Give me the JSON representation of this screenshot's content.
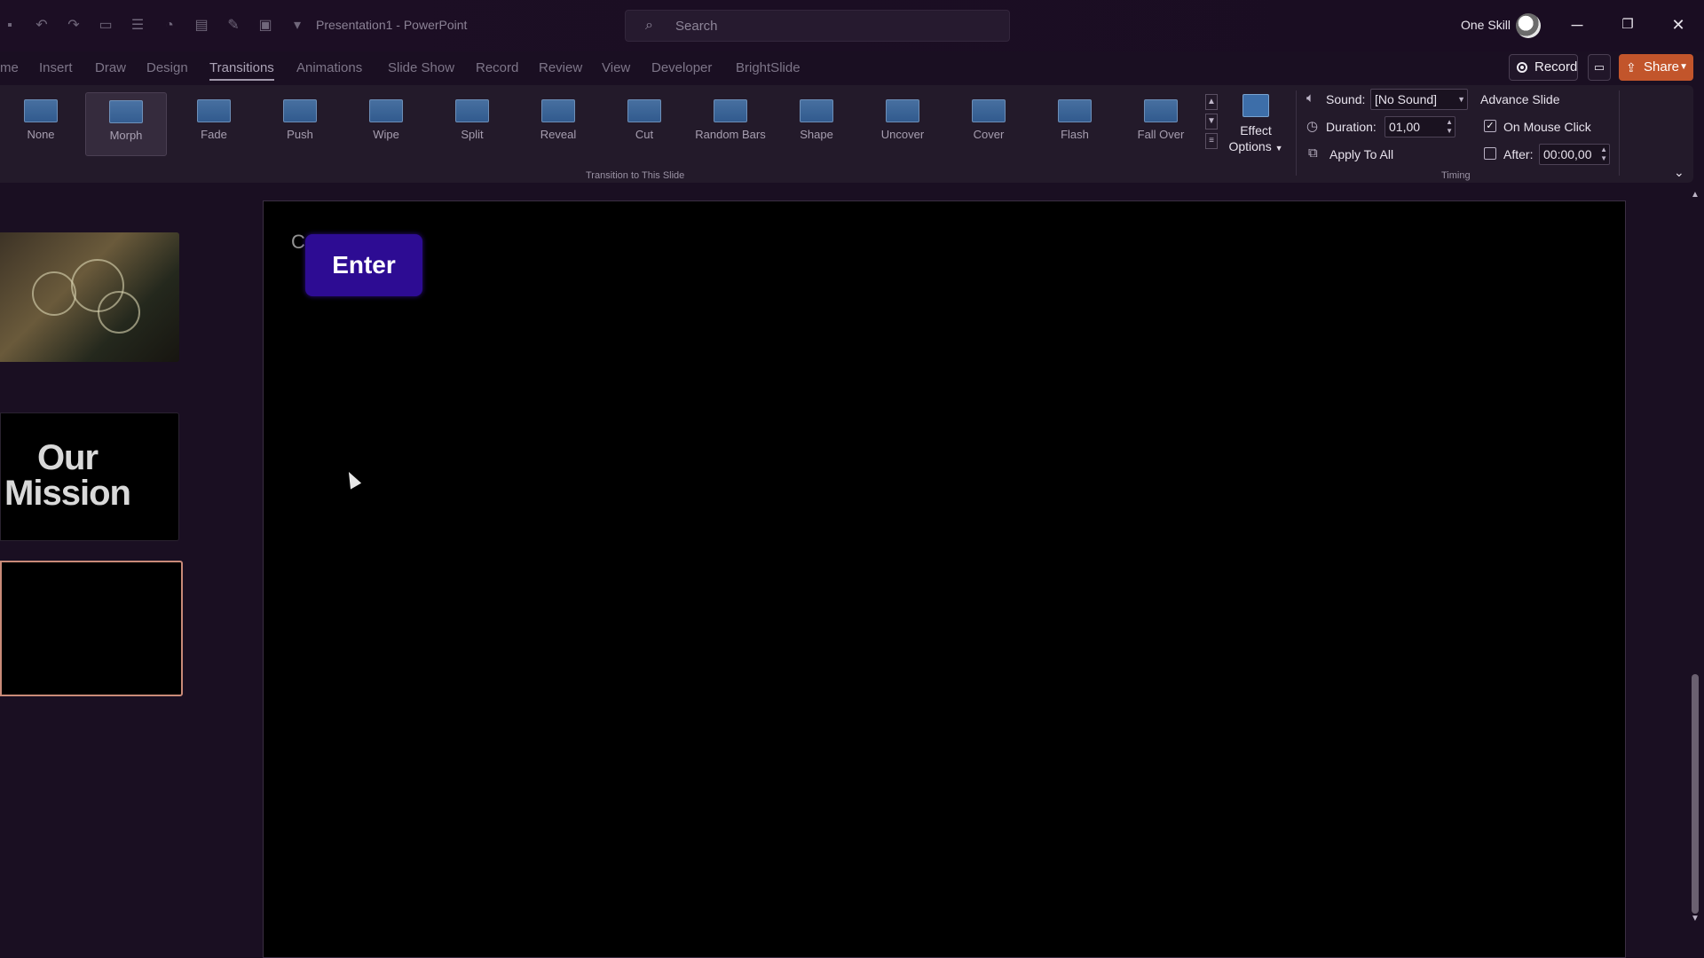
{
  "window": {
    "title": "Presentation1 - PowerPoint",
    "search_placeholder": "Search",
    "user_name": "One Skill",
    "minimize_glyph": "─",
    "restore_glyph": "❐",
    "close_glyph": "✕"
  },
  "quick_access_icons": [
    "autosave-icon",
    "undo-icon",
    "redo-icon",
    "toolbar-icon-1",
    "toolbar-icon-2",
    "toolbar-icon-3",
    "toolbar-icon-4",
    "toolbar-icon-5",
    "toolbar-icon-6",
    "customize-qat-icon"
  ],
  "tabs": [
    {
      "label": "me",
      "active": false
    },
    {
      "label": "Insert",
      "active": false
    },
    {
      "label": "Draw",
      "active": false
    },
    {
      "label": "Design",
      "active": false
    },
    {
      "label": "Transitions",
      "active": true
    },
    {
      "label": "Animations",
      "active": false
    },
    {
      "label": "Slide Show",
      "active": false
    },
    {
      "label": "Record",
      "active": false
    },
    {
      "label": "Review",
      "active": false
    },
    {
      "label": "View",
      "active": false
    },
    {
      "label": "Developer",
      "active": false
    },
    {
      "label": "BrightSlide",
      "active": false
    }
  ],
  "header_buttons": {
    "record": "Record",
    "share": "Share",
    "share_color": "#c2552b"
  },
  "transitions": {
    "items": [
      {
        "label": "None",
        "selected": false
      },
      {
        "label": "Morph",
        "selected": true
      },
      {
        "label": "Fade",
        "selected": false
      },
      {
        "label": "Push",
        "selected": false
      },
      {
        "label": "Wipe",
        "selected": false
      },
      {
        "label": "Split",
        "selected": false
      },
      {
        "label": "Reveal",
        "selected": false
      },
      {
        "label": "Cut",
        "selected": false
      },
      {
        "label": "Random Bars",
        "selected": false
      },
      {
        "label": "Shape",
        "selected": false
      },
      {
        "label": "Uncover",
        "selected": false
      },
      {
        "label": "Cover",
        "selected": false
      },
      {
        "label": "Flash",
        "selected": false
      },
      {
        "label": "Fall Over",
        "selected": false
      }
    ],
    "effect_options_line1": "Effect",
    "effect_options_line2": "Options",
    "group_label": "Transition to This Slide"
  },
  "timing": {
    "sound_label": "Sound:",
    "sound_value": "[No Sound]",
    "duration_label": "Duration:",
    "duration_value": "01,00",
    "apply_to_all": "Apply To All",
    "advance_slide": "Advance Slide",
    "on_mouse_click": "On Mouse Click",
    "on_mouse_click_checked": true,
    "after_label": "After:",
    "after_value": "00:00,00",
    "after_checked": false,
    "group_label": "Timing"
  },
  "slides_panel": {
    "thumb2_text_line1": "Our",
    "thumb2_text_line2": "Mission",
    "selected_border_color": "#c98a78"
  },
  "slide": {
    "marker": "C",
    "button_label": "Enter",
    "button_color": "#2d0c93"
  }
}
